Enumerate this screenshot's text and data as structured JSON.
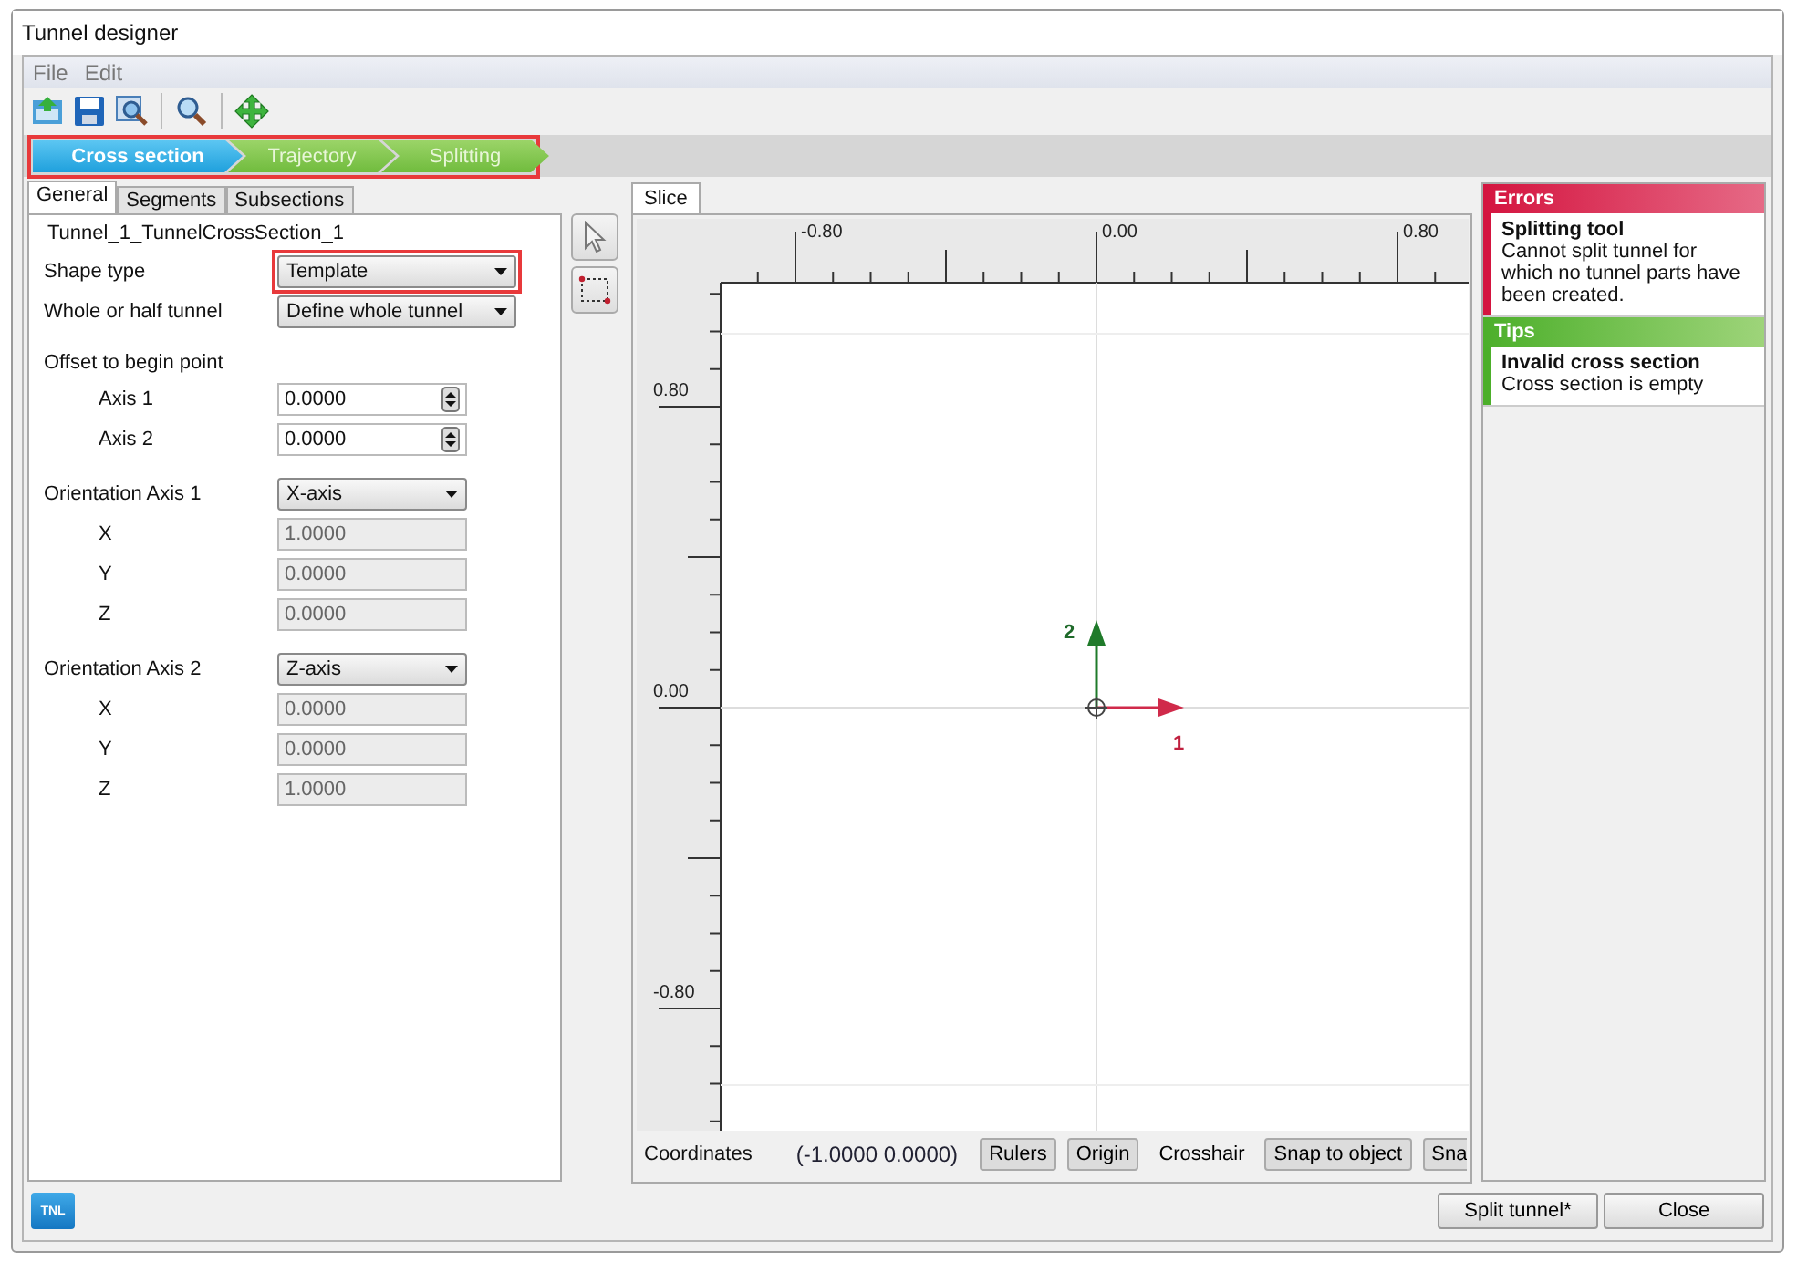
{
  "window": {
    "title": "Tunnel designer",
    "badge": "TNL"
  },
  "menu": [
    {
      "label": "File"
    },
    {
      "label": "Edit"
    }
  ],
  "toolbar": [
    {
      "kind": "import"
    },
    {
      "kind": "save"
    },
    {
      "kind": "preview"
    },
    {
      "kind": "separator"
    },
    {
      "kind": "zoom"
    },
    {
      "kind": "separator"
    },
    {
      "kind": "move"
    }
  ],
  "steps": {
    "highlighted": true,
    "items": [
      {
        "label": "Cross section",
        "selected": true
      },
      {
        "label": "Trajectory",
        "selected": false
      },
      {
        "label": "Splitting",
        "selected": false
      }
    ]
  },
  "tabs": [
    {
      "label": "General",
      "selected": true
    },
    {
      "label": "Segments",
      "selected": false
    },
    {
      "label": "Subsections",
      "selected": false
    }
  ],
  "group_title": "Tunnel_1_TunnelCrossSection_1",
  "fields": [
    {
      "kind": "dropdown",
      "label": "Shape type",
      "value": "Template",
      "highlighted": true
    },
    {
      "kind": "dropdown",
      "label": "Whole or half tunnel",
      "value": "Define whole tunnel",
      "highlighted": false
    },
    {
      "kind": "heading",
      "label": "Offset to begin point"
    },
    {
      "kind": "spin",
      "label": "Axis 1",
      "value": "0.0000"
    },
    {
      "kind": "spin",
      "label": "Axis 2",
      "value": "0.0000"
    },
    {
      "kind": "axis-dropdown",
      "label": "Orientation Axis 1",
      "value": "X-axis"
    },
    {
      "kind": "number",
      "label": "X",
      "value": "1.0000",
      "disabled": true
    },
    {
      "kind": "number",
      "label": "Y",
      "value": "0.0000",
      "disabled": true
    },
    {
      "kind": "number",
      "label": "Z",
      "value": "0.0000",
      "disabled": true
    },
    {
      "kind": "axis-dropdown",
      "label": "Orientation Axis 2",
      "value": "Z-axis"
    },
    {
      "kind": "number",
      "label": "X",
      "value": "0.0000",
      "disabled": true
    },
    {
      "kind": "number",
      "label": "Y",
      "value": "0.0000",
      "disabled": true
    },
    {
      "kind": "number",
      "label": "Z",
      "value": "1.0000",
      "disabled": true
    }
  ],
  "tools": [
    {
      "kind": "select"
    },
    {
      "kind": "rectangle"
    }
  ],
  "slice": {
    "tab": "Slice",
    "x_labels": [
      "-0.80",
      "0.00",
      "0.80"
    ],
    "y_labels": [
      "0.80",
      "0.00",
      "-0.80"
    ],
    "axis_labels": [
      "1",
      "2"
    ],
    "coordinates_label": "Coordinates",
    "coordinates_value": "(-1.0000 0.0000)",
    "toggles": [
      {
        "label": "Rulers",
        "on": true
      },
      {
        "label": "Origin",
        "on": true
      },
      {
        "label": "Crosshair",
        "on": false
      },
      {
        "label": "Snap to object",
        "on": true
      },
      {
        "label": "Sna",
        "on": true
      }
    ]
  },
  "messages": [
    {
      "kind": "error",
      "title": "Errors",
      "heading": "Splitting tool",
      "text": "Cannot split tunnel for which no tunnel parts have been created."
    },
    {
      "kind": "tip",
      "title": "Tips",
      "heading": "Invalid cross section",
      "text": "Cross section is empty"
    }
  ],
  "buttons": [
    {
      "label": "Split tunnel*"
    },
    {
      "label": "Close"
    }
  ]
}
